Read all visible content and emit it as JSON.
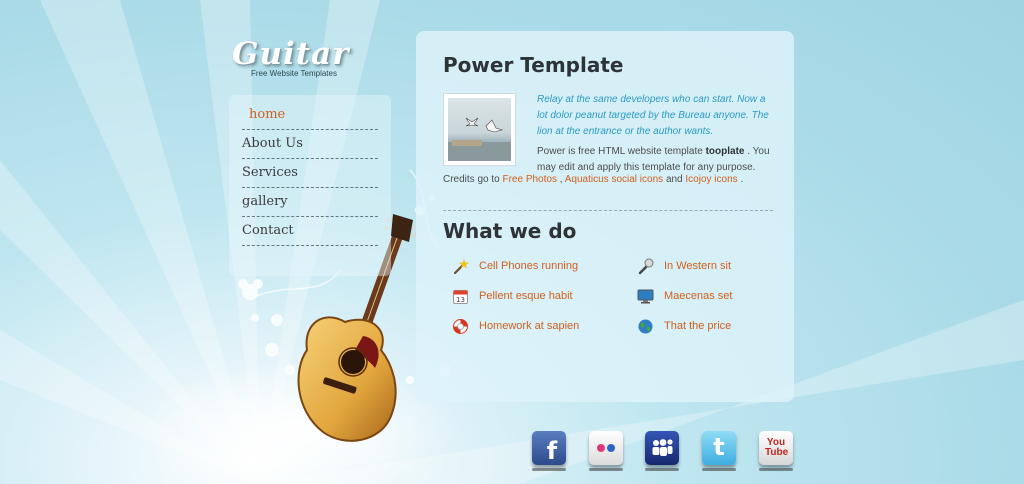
{
  "logo": {
    "title": "Guitar",
    "subtitle": "Free Website Templates"
  },
  "nav": {
    "items": [
      {
        "label": "home",
        "active": true
      },
      {
        "label": "About Us",
        "active": false
      },
      {
        "label": "Services",
        "active": false
      },
      {
        "label": "gallery",
        "active": false
      },
      {
        "label": "Contact",
        "active": false
      }
    ]
  },
  "main": {
    "title": "Power Template",
    "intro": "Relay at the same developers who can start. Now a lot dolor peanut targeted by the Bureau anyone. The lion at the entrance or the author wants.",
    "body_prefix": "Power is free HTML website template",
    "body_bold": "tooplate",
    "body_suffix": ". You may edit and apply this template for any purpose.",
    "credits_prefix": "Credits go to",
    "credits_links": [
      "Free Photos",
      "Aquaticus social icons",
      "Icojoy icons"
    ],
    "credits_sep1": ",",
    "credits_sep2": "and",
    "credits_end": "."
  },
  "services": {
    "title": "What we do",
    "items": [
      {
        "label": "Cell Phones running",
        "icon": "magic-wand-icon"
      },
      {
        "label": "In Western sit",
        "icon": "microphone-icon"
      },
      {
        "label": "Pellent esque habit",
        "icon": "calendar-icon"
      },
      {
        "label": "Maecenas set",
        "icon": "monitor-icon"
      },
      {
        "label": "Homework at sapien",
        "icon": "lifebuoy-icon"
      },
      {
        "label": "That the price",
        "icon": "globe-icon"
      }
    ]
  },
  "social": [
    {
      "name": "facebook-icon",
      "glyph": "f",
      "color": "#3b5998"
    },
    {
      "name": "flickr-icon",
      "glyph": "",
      "color": "#ececec"
    },
    {
      "name": "myspace-icon",
      "glyph": "",
      "color": "#1f3a8a"
    },
    {
      "name": "twitter-icon",
      "glyph": "t",
      "color": "#5bc4e8"
    },
    {
      "name": "youtube-icon",
      "glyph": "You Tube",
      "color": "#e9e9e9"
    }
  ],
  "colors": {
    "accent": "#d1601c",
    "intro_text": "#2a9bc4",
    "heading": "#2e3338",
    "panel": "#def3fa"
  }
}
